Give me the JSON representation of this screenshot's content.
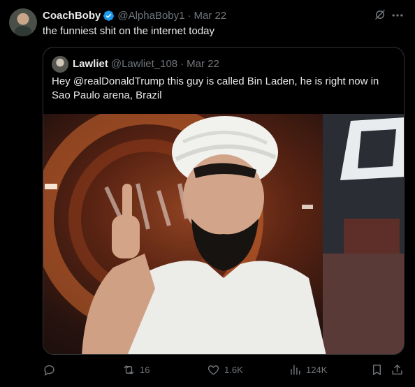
{
  "tweet": {
    "author_name": "CoachBoby",
    "author_handle": "@AlphaBoby1",
    "separator": "·",
    "date": "Mar 22",
    "text": "the funniest shit on the internet today"
  },
  "quoted": {
    "author_name": "Lawliet",
    "author_handle": "@Lawliet_108",
    "separator": "·",
    "date": "Mar 22",
    "text": "Hey @realDonaldTrump this guy is called Bin Laden, he is right now in Sao Paulo arena, Brazil"
  },
  "actions": {
    "replies": "",
    "retweets": "16",
    "likes": "1.6K",
    "views": "124K"
  },
  "colors": {
    "background": "#000000",
    "text": "#e7e9ea",
    "muted": "#71767b",
    "border": "#2f3336",
    "verified": "#1d9bf0"
  },
  "icons": [
    "verified-badge-icon",
    "grok-icon",
    "more-icon",
    "reply-icon",
    "retweet-icon",
    "like-icon",
    "views-icon",
    "bookmark-icon",
    "share-icon"
  ]
}
